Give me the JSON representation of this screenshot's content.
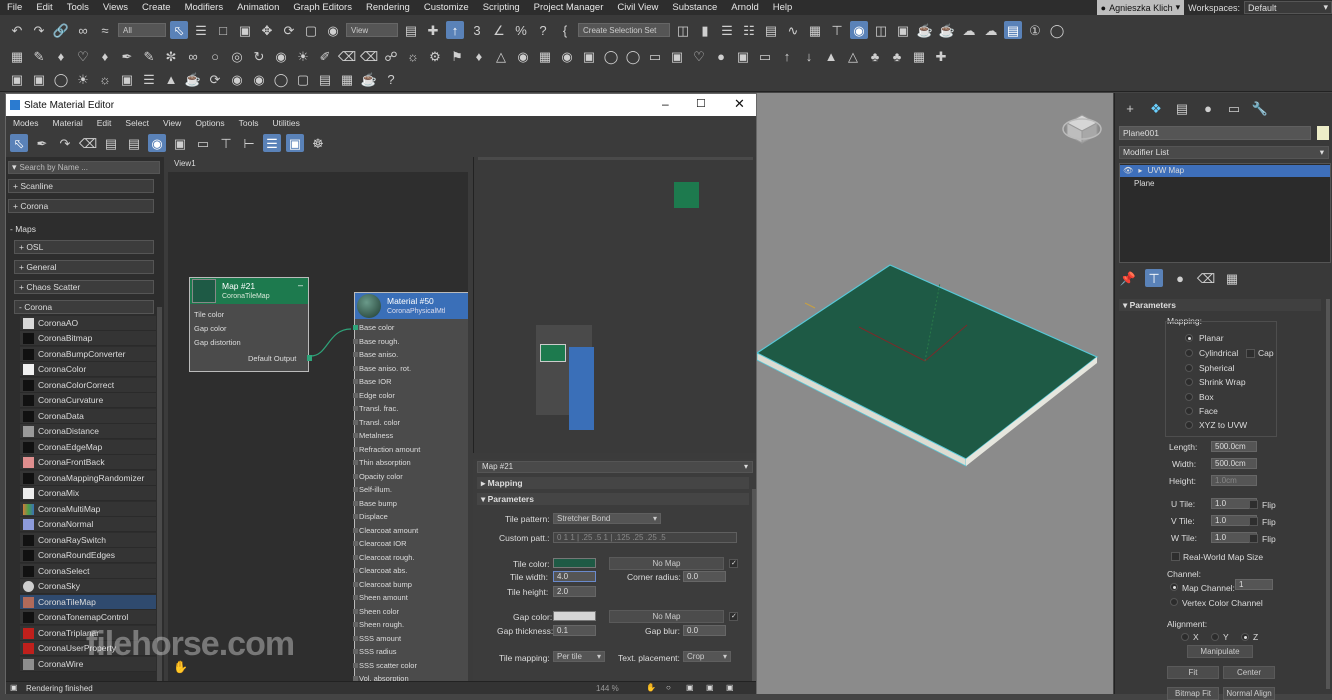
{
  "app": {
    "menu": [
      "File",
      "Edit",
      "Tools",
      "Views",
      "Create",
      "Modifiers",
      "Animation",
      "Graph Editors",
      "Rendering",
      "Customize",
      "Scripting",
      "Project Manager",
      "Civil View",
      "Substance",
      "Arnold",
      "Help"
    ],
    "user": "Agnieszka Klich",
    "workspaces_label": "Workspaces:",
    "workspace": "Default",
    "selection_filter": "All",
    "ref_coord": "View",
    "selection_set": "Create Selection Set"
  },
  "sme": {
    "title": "Slate Material Editor",
    "menu": [
      "Modes",
      "Material",
      "Edit",
      "Select",
      "View",
      "Options",
      "Tools",
      "Utilities"
    ],
    "search_placeholder": "Search by Name ...",
    "view_tab": "View1",
    "groups": [
      "+ Scanline",
      "+ Corona",
      "- Maps",
      "+ OSL",
      "+ General",
      "+ Chaos Scatter",
      "- Corona"
    ],
    "items": [
      {
        "label": "CoronaAO",
        "color": "#d9d9d9"
      },
      {
        "label": "CoronaBitmap",
        "color": "#111111"
      },
      {
        "label": "CoronaBumpConverter",
        "color": "#111111"
      },
      {
        "label": "CoronaColor",
        "color": "#f2f2f2"
      },
      {
        "label": "CoronaColorCorrect",
        "color": "#111111"
      },
      {
        "label": "CoronaCurvature",
        "color": "#111111"
      },
      {
        "label": "CoronaData",
        "color": "#111111"
      },
      {
        "label": "CoronaDistance",
        "color": "#9a9a9a"
      },
      {
        "label": "CoronaEdgeMap",
        "color": "#111111"
      },
      {
        "label": "CoronaFrontBack",
        "color": "#e08f8f"
      },
      {
        "label": "CoronaMappingRandomizer",
        "color": "#111111"
      },
      {
        "label": "CoronaMix",
        "color": "#eeeeee"
      },
      {
        "label": "CoronaMultiMap",
        "color": "#d27a3a"
      },
      {
        "label": "CoronaNormal",
        "color": "#8d9bdb"
      },
      {
        "label": "CoronaRaySwitch",
        "color": "#111111"
      },
      {
        "label": "CoronaRoundEdges",
        "color": "#111111"
      },
      {
        "label": "CoronaSelect",
        "color": "#111111"
      },
      {
        "label": "CoronaSky",
        "color": "#cfcfcf"
      },
      {
        "label": "CoronaTileMap",
        "color": "#b06a5a"
      },
      {
        "label": "CoronaTonemapControl",
        "color": "#111111"
      },
      {
        "label": "CoronaTriplanar",
        "color": "#c0201c"
      },
      {
        "label": "CoronaUserProperty",
        "color": "#c0201c"
      },
      {
        "label": "CoronaWire",
        "color": "#8f8f8f"
      }
    ],
    "map_node": {
      "title": "Map #21",
      "subtitle": "CoronaTileMap",
      "slots": [
        "Tile color",
        "Gap color",
        "Gap distortion"
      ],
      "output": "Default Output"
    },
    "mat_node": {
      "title": "Material #50",
      "subtitle": "CoronaPhysicalMtl",
      "slots": [
        "Base color",
        "Base rough.",
        "Base aniso.",
        "Base aniso. rot.",
        "Base IOR",
        "Edge color",
        "Transl. frac.",
        "Transl. color",
        "Metalness",
        "Refraction amount",
        "Thin absorption",
        "Opacity color",
        "Self-illum.",
        "Base bump",
        "Displace",
        "Clearcoat amount",
        "Clearcoat IOR",
        "Clearcoat rough.",
        "Clearcoat abs.",
        "Clearcoat bump",
        "Sheen amount",
        "Sheen color",
        "Sheen rough.",
        "SSS amount",
        "SSS radius",
        "SSS scatter color",
        "Vol. absorption"
      ]
    },
    "params": {
      "header": "Map #21",
      "mapping_rollout": "Mapping",
      "parameters_rollout": "Parameters",
      "tile_pattern_label": "Tile pattern:",
      "tile_pattern": "Stretcher Bond",
      "custom_patt_label": "Custom patt.:",
      "custom_patt": "0 1 1 | .25 .5 1 | .125 .25 .25 .5",
      "tile_color_label": "Tile color:",
      "tile_color": "#1e5a45",
      "no_map": "No Map",
      "tile_width_label": "Tile width:",
      "tile_width": "4.0",
      "corner_radius_label": "Corner radius:",
      "corner_radius": "0.0",
      "tile_height_label": "Tile height:",
      "tile_height": "2.0",
      "gap_color_label": "Gap color:",
      "gap_color": "#d6d6d6",
      "gap_thickness_label": "Gap thickness:",
      "gap_thickness": "0.1",
      "gap_blur_label": "Gap blur:",
      "gap_blur": "0.0",
      "tile_mapping_label": "Tile mapping:",
      "tile_mapping": "Per tile",
      "text_placement_label": "Text. placement:",
      "text_placement": "Crop"
    },
    "status": "Rendering finished",
    "zoom": "144 %"
  },
  "cmd": {
    "object_name": "Plane001",
    "modifier_list": "Modifier List",
    "stack": [
      "UVW Map",
      "Plane"
    ],
    "rollout": "Parameters",
    "mapping_label": "Mapping:",
    "mapping_options": [
      "Planar",
      "Cylindrical",
      "Spherical",
      "Shrink Wrap",
      "Box",
      "Face",
      "XYZ to UVW"
    ],
    "cap_label": "Cap",
    "length_label": "Length:",
    "length": "500.0cm",
    "width_label": "Width:",
    "width": "500.0cm",
    "height_label": "Height:",
    "height": "1.0cm",
    "u_tile_label": "U Tile:",
    "u_tile": "1.0",
    "v_tile_label": "V Tile:",
    "v_tile": "1.0",
    "w_tile_label": "W Tile:",
    "w_tile": "1.0",
    "flip_label": "Flip",
    "real_world": "Real-World Map Size",
    "channel_label": "Channel:",
    "map_channel_label": "Map Channel:",
    "map_channel": "1",
    "vertex_color": "Vertex Color Channel",
    "alignment_label": "Alignment:",
    "axes": [
      "X",
      "Y",
      "Z"
    ],
    "manipulate": "Manipulate",
    "fit": "Fit",
    "center": "Center",
    "bitmap_fit": "Bitmap Fit",
    "normal_align": "Normal Align"
  },
  "watermark": "filehorse.com",
  "colors": {
    "accent": "#5a82b8",
    "plane_green": "#1e5a45",
    "node_map": "#1d7a4e",
    "node_mat": "#3a6fb8"
  }
}
